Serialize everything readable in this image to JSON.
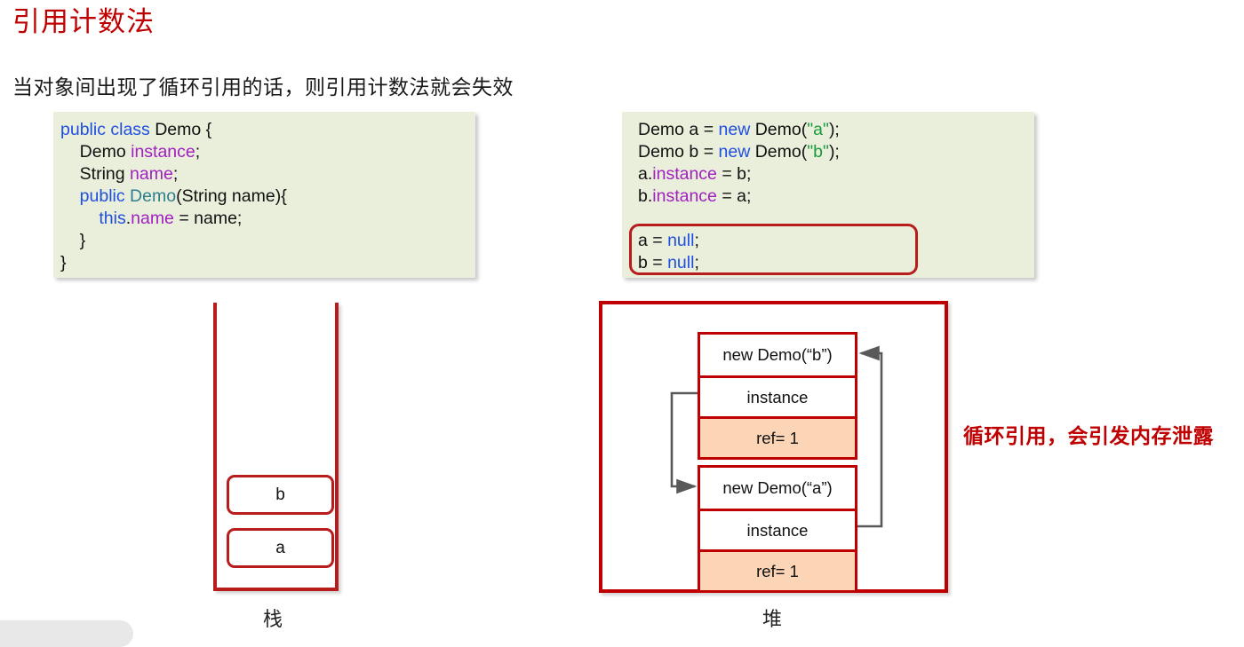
{
  "slide": {
    "title": "引用计数法",
    "subtitle": "当对象间出现了循环引用的话，则引用计数法就会失效",
    "leak_note": "循环引用，会引发内存泄露"
  },
  "code_left": {
    "lines": [
      [
        {
          "t": "public class ",
          "c": "kw"
        },
        {
          "t": "Demo {",
          "c": "pln"
        }
      ],
      [
        {
          "t": "    Demo ",
          "c": "pln"
        },
        {
          "t": "instance",
          "c": "fld"
        },
        {
          "t": ";",
          "c": "pln"
        }
      ],
      [
        {
          "t": "    String ",
          "c": "pln"
        },
        {
          "t": "name",
          "c": "fld"
        },
        {
          "t": ";",
          "c": "pln"
        }
      ],
      [
        {
          "t": "    public ",
          "c": "kw"
        },
        {
          "t": "Demo",
          "c": "cls"
        },
        {
          "t": "(String name){",
          "c": "pln"
        }
      ],
      [
        {
          "t": "        ",
          "c": "pln"
        },
        {
          "t": "this",
          "c": "kw"
        },
        {
          "t": ".",
          "c": "pln"
        },
        {
          "t": "name",
          "c": "fld"
        },
        {
          "t": " = name;",
          "c": "pln"
        }
      ],
      [
        {
          "t": "    }",
          "c": "pln"
        }
      ],
      [
        {
          "t": "}",
          "c": "pln"
        }
      ]
    ]
  },
  "code_right": {
    "lines": [
      [
        {
          "t": "Demo a = ",
          "c": "pln"
        },
        {
          "t": "new",
          "c": "kw"
        },
        {
          "t": " Demo(",
          "c": "pln"
        },
        {
          "t": "\"a\"",
          "c": "str"
        },
        {
          "t": ");",
          "c": "pln"
        }
      ],
      [
        {
          "t": "Demo b = ",
          "c": "pln"
        },
        {
          "t": "new",
          "c": "kw"
        },
        {
          "t": " Demo(",
          "c": "pln"
        },
        {
          "t": "\"b\"",
          "c": "str"
        },
        {
          "t": ");",
          "c": "pln"
        }
      ],
      [
        {
          "t": "a.",
          "c": "pln"
        },
        {
          "t": "instance",
          "c": "fld"
        },
        {
          "t": " = b;",
          "c": "pln"
        }
      ],
      [
        {
          "t": "b.",
          "c": "pln"
        },
        {
          "t": "instance",
          "c": "fld"
        },
        {
          "t": " = a;",
          "c": "pln"
        }
      ],
      [
        {
          "t": "",
          "c": "pln"
        }
      ],
      [
        {
          "t": "a = ",
          "c": "pln"
        },
        {
          "t": "null",
          "c": "kw"
        },
        {
          "t": ";",
          "c": "pln"
        }
      ],
      [
        {
          "t": "b = ",
          "c": "pln"
        },
        {
          "t": "null",
          "c": "kw"
        },
        {
          "t": ";",
          "c": "pln"
        }
      ]
    ],
    "highlight_label": "a = null; b = null;"
  },
  "stack": {
    "caption": "栈",
    "frames": [
      {
        "label": "b"
      },
      {
        "label": "a"
      }
    ]
  },
  "heap": {
    "caption": "堆",
    "objects": [
      {
        "id": "b",
        "title": "new Demo(“b”)",
        "field": "instance",
        "ref": "ref= 1"
      },
      {
        "id": "a",
        "title": "new Demo(“a”)",
        "field": "instance",
        "ref": "ref= 1"
      }
    ]
  },
  "colors": {
    "title_red": "#c00000",
    "border_red": "#b81c1c",
    "code_bg": "#eaefdc",
    "ref_orange": "#fbd5b5",
    "keyword_blue": "#1f4fe0",
    "field_purple": "#a020c0",
    "class_teal": "#2d7f8f",
    "string_green": "#1a9a3c",
    "arrow_gray": "#595959"
  }
}
